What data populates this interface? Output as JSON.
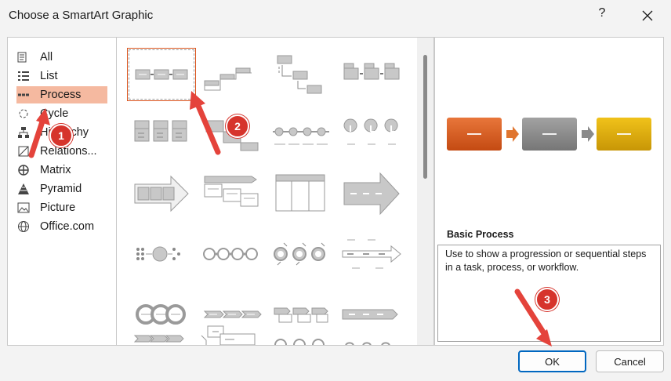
{
  "window": {
    "title": "Choose a SmartArt Graphic",
    "help_label": "?"
  },
  "categories": [
    {
      "label": "All",
      "icon": "all-icon"
    },
    {
      "label": "List",
      "icon": "list-icon"
    },
    {
      "label": "Process",
      "icon": "process-icon",
      "selected": true
    },
    {
      "label": "Cycle",
      "icon": "cycle-icon"
    },
    {
      "label": "Hierarchy",
      "icon": "hierarchy-icon"
    },
    {
      "label": "Relations...",
      "icon": "relationship-icon"
    },
    {
      "label": "Matrix",
      "icon": "matrix-icon"
    },
    {
      "label": "Pyramid",
      "icon": "pyramid-icon"
    },
    {
      "label": "Picture",
      "icon": "picture-icon"
    },
    {
      "label": "Office.com",
      "icon": "globe-icon"
    }
  ],
  "preview": {
    "name": "Basic Process",
    "description": "Use to show a progression or sequential steps in a task, process, or workflow.",
    "box_colors": [
      "#d9541e",
      "#8c8c8c",
      "#d4a00a"
    ],
    "box_label": "—"
  },
  "buttons": {
    "ok": "OK",
    "cancel": "Cancel"
  },
  "annotations": [
    "1",
    "2",
    "3"
  ],
  "accent": "#d6342c"
}
